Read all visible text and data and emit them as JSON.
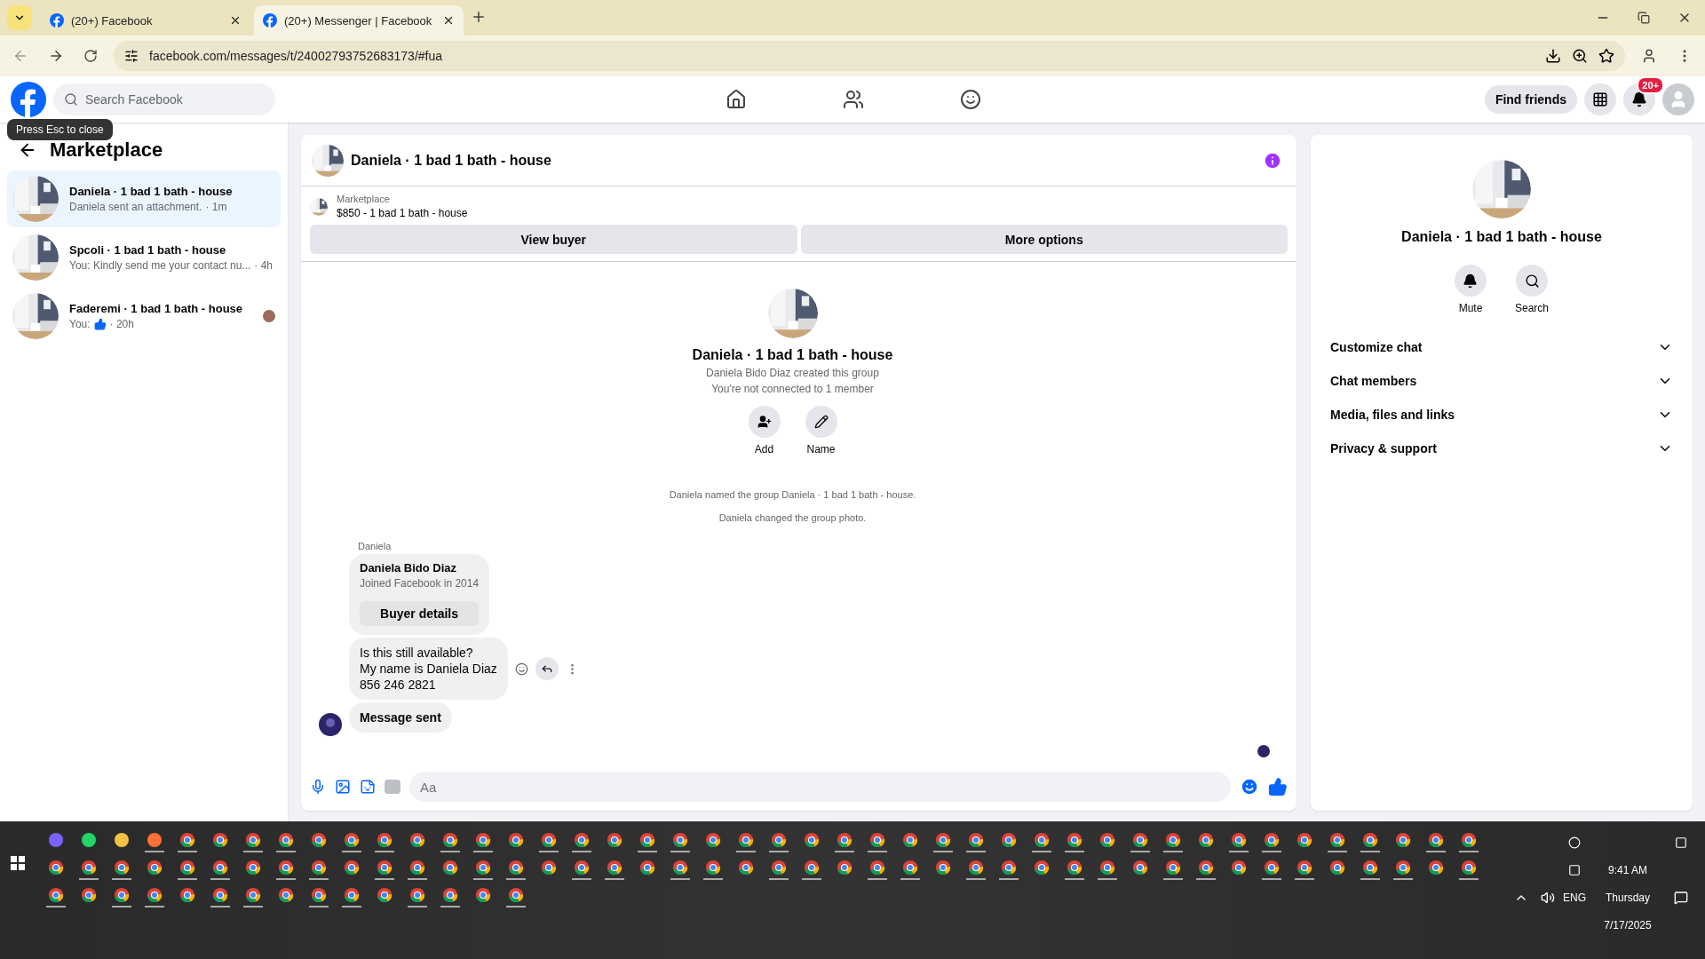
{
  "browser": {
    "tabs": [
      {
        "title": "(20+) Facebook",
        "selected": false
      },
      {
        "title": "(20+) Messenger | Facebook",
        "selected": true
      }
    ],
    "url": "facebook.com/messages/t/24002793752683173/#fua"
  },
  "header": {
    "search_placeholder": "Search Facebook",
    "find_friends": "Find friends",
    "notification_badge": "20+"
  },
  "tooltip": "Press Esc to close",
  "sidebar": {
    "title": "Marketplace",
    "conversations": [
      {
        "name": "Daniela · 1 bad 1 bath - house",
        "preview": "Daniela sent an attachment.",
        "time": "· 1m",
        "kind": "text",
        "seen": false,
        "selected": true
      },
      {
        "name": "Spcoli · 1 bad 1 bath - house",
        "preview": "You: Kindly send me your contact nu...",
        "time": "· 4h",
        "kind": "text",
        "seen": false,
        "selected": false
      },
      {
        "name": "Faderemi · 1 bad 1 bath - house",
        "preview": "You:",
        "time": "· 20h",
        "kind": "like",
        "seen": true,
        "selected": false
      }
    ]
  },
  "chat": {
    "title": "Daniela · 1 bad 1 bath - house",
    "listing_label": "Marketplace",
    "listing": "$850 - 1 bad 1 bath - house",
    "buttons": [
      "View buyer",
      "More options"
    ],
    "intro": {
      "title": "Daniela · 1 bad 1 bath - house",
      "lines": [
        "Daniela Bido Diaz created this group",
        "You're not connected to 1 member"
      ],
      "actions": [
        {
          "kind": "add",
          "label": "Add"
        },
        {
          "kind": "edit",
          "label": "Name"
        }
      ]
    },
    "events": [
      "Daniela named the group Daniela · 1 bad 1 bath - house.",
      "Daniela changed the group photo."
    ],
    "sender": "Daniela",
    "buyer_card": {
      "name": "Daniela Bido Diaz",
      "subtitle": "Joined Facebook in 2014",
      "button": "Buyer details"
    },
    "messages": [
      {
        "kind": "text",
        "text": "Is this still available?\nMy name is Daniela Diaz\n856 246 2821"
      },
      {
        "kind": "bold",
        "text": "Message sent"
      }
    ],
    "composer_placeholder": "Aa"
  },
  "details": {
    "title": "Daniela · 1 bad 1 bath - house",
    "actions": [
      {
        "kind": "mute",
        "label": "Mute"
      },
      {
        "kind": "search",
        "label": "Search"
      }
    ],
    "sections": [
      {
        "label": "Customize chat",
        "expanded": false
      },
      {
        "label": "Chat members",
        "expanded": false
      },
      {
        "label": "Media, files and links",
        "expanded": false
      },
      {
        "label": "Privacy & support",
        "expanded": false
      }
    ]
  },
  "taskbar": {
    "language": "ENG",
    "time": "9:41 AM",
    "day": "Thursday",
    "date": "7/17/2025"
  }
}
